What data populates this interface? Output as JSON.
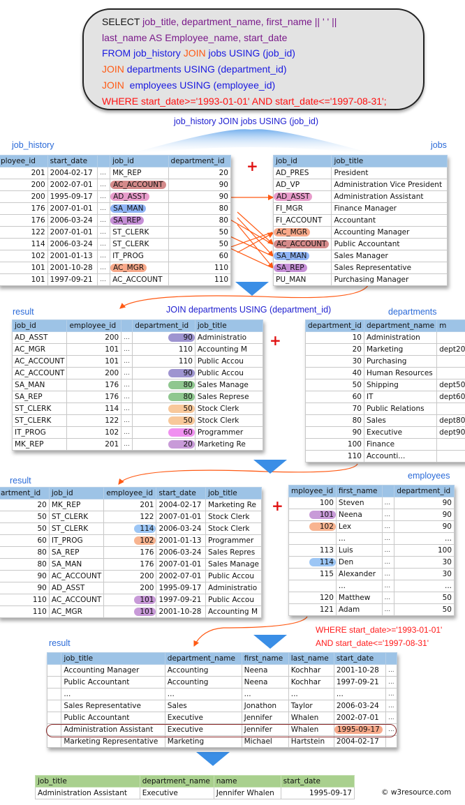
{
  "sql": {
    "lines": [
      [
        {
          "t": "SELECT ",
          "c": "black"
        },
        {
          "t": "job_title, department_name, first_name || ' ' ||",
          "c": "purple"
        }
      ],
      [
        {
          "t": "last_name AS Employee_name, start_date",
          "c": "purple"
        }
      ],
      [
        {
          "t": "FROM job_history ",
          "c": "blue"
        },
        {
          "t": "JOIN",
          "c": "orange"
        },
        {
          "t": " jobs USING (job_id)",
          "c": "blue"
        }
      ],
      [
        {
          "t": "JOIN",
          "c": "orange"
        },
        {
          "t": " departments USING (department_id)",
          "c": "blue"
        }
      ],
      [
        {
          "t": "JOIN",
          "c": "orange"
        },
        {
          "t": "  employees USING (employee_id)",
          "c": "blue"
        }
      ],
      [
        {
          "t": "WHERE start_date>='1993-01-01' AND start_date<='1997-08-31';",
          "c": "red"
        }
      ]
    ]
  },
  "captions": {
    "step1": "job_history JOIN jobs USING (job_id)",
    "step2": "JOIN departments USING (department_id)",
    "step3_line1": "WHERE start_date>='1993-01-01'",
    "step3_line2": "AND start_date<='1997-08-31'"
  },
  "labels": {
    "job_history": "job_history",
    "jobs": "jobs",
    "result1": "result",
    "departments": "departments",
    "result2": "result",
    "employees": "employees",
    "result3": "result"
  },
  "colors": {
    "ac_account": "#d48a8a",
    "ad_asst": "#e89ccb",
    "sa_man": "#8fb4f5",
    "sa_rep": "#c58fd6",
    "ac_mgr": "#f8a98a",
    "dept90": "#9e94d0",
    "dept80": "#8fc78f",
    "dept50": "#f8c89a",
    "dept60": "#f090f0",
    "dept20": "#c89ad8",
    "emp101": "#c89ad8",
    "emp102": "#f8b490",
    "emp114": "#9cc6f5",
    "final_date": "#f6a98a",
    "arrow": "#ff5a14",
    "header_blue": "#9dc3e6",
    "header_green": "#a9d08e"
  },
  "job_history": {
    "headers": [
      "ployee_id",
      "start_date",
      "",
      "job_id",
      "department_id"
    ],
    "rows": [
      [
        "201",
        "2004-02-17",
        "...",
        "MK_REP",
        "20",
        ""
      ],
      [
        "200",
        "2002-07-01",
        "...",
        "AC_ACCOUNT",
        "90",
        "ac_account"
      ],
      [
        "200",
        "1995-09-17",
        "...",
        "AD_ASST",
        "90",
        "ad_asst"
      ],
      [
        "176",
        "2007-01-01",
        "...",
        "SA_MAN",
        "80",
        "sa_man"
      ],
      [
        "176",
        "2006-03-24",
        "...",
        "SA_REP",
        "80",
        "sa_rep"
      ],
      [
        "122",
        "2007-01-01",
        "...",
        "ST_CLERK",
        "50",
        ""
      ],
      [
        "114",
        "2006-03-24",
        "...",
        "ST_CLERK",
        "50",
        ""
      ],
      [
        "102",
        "2001-01-13",
        "...",
        "IT_PROG",
        "60",
        ""
      ],
      [
        "101",
        "2001-10-28",
        "...",
        "AC_MGR",
        "110",
        "ac_mgr"
      ],
      [
        "101",
        "1997-09-21",
        "...",
        "AC_ACCOUNT",
        "110",
        ""
      ]
    ]
  },
  "jobs": {
    "headers": [
      "job_id",
      "job_title"
    ],
    "rows": [
      [
        "AD_PRES",
        "President",
        ""
      ],
      [
        "AD_VP",
        "Administration Vice President",
        ""
      ],
      [
        "AD_ASST",
        "Administration Assistant",
        "ad_asst"
      ],
      [
        "FI_MGR",
        "Finance Manager",
        ""
      ],
      [
        "FI_ACCOUNT",
        "Accountant",
        ""
      ],
      [
        "AC_MGR",
        "Accounting Manager",
        "ac_mgr"
      ],
      [
        "AC_ACCOUNT",
        "Public Accountant",
        "ac_account"
      ],
      [
        "SA_MAN",
        "Sales Manager",
        "sa_man"
      ],
      [
        "SA_REP",
        "Sales Representative",
        "sa_rep"
      ],
      [
        "PU_MAN",
        "Purchasing Manager",
        ""
      ]
    ]
  },
  "result1": {
    "headers": [
      "job_id",
      "employee_id",
      "",
      "department_id",
      "job_title"
    ],
    "rows": [
      [
        "AD_ASST",
        "200",
        "...",
        "90",
        "Administratio",
        "dept90"
      ],
      [
        "AC_MGR",
        "101",
        "...",
        "110",
        "Accounting M",
        ""
      ],
      [
        "AC_ACCOUNT",
        "101",
        "...",
        "110",
        "Public Accou",
        ""
      ],
      [
        "AC_ACCOUNT",
        "200",
        "...",
        "90",
        "Public Accou",
        "dept90"
      ],
      [
        "SA_MAN",
        "176",
        "...",
        "80",
        "Sales Manage",
        "dept80"
      ],
      [
        "SA_REP",
        "176",
        "...",
        "80",
        "Sales Represe",
        "dept80"
      ],
      [
        "ST_CLERK",
        "114",
        "...",
        "50",
        "Stock Clerk",
        "dept50"
      ],
      [
        "ST_CLERK",
        "122",
        "...",
        "50",
        "Stock Clerk",
        "dept50"
      ],
      [
        "IT_PROG",
        "102",
        "...",
        "60",
        "Programmer",
        "dept60"
      ],
      [
        "MK_REP",
        "201",
        "...",
        "20",
        "Marketing Re",
        "dept20"
      ]
    ]
  },
  "departments": {
    "headers": [
      "department_id",
      "department_name",
      "m"
    ],
    "rows": [
      [
        "10",
        "Administration",
        ""
      ],
      [
        "20",
        "Marketing",
        "dept20"
      ],
      [
        "30",
        "Purchasing",
        ""
      ],
      [
        "40",
        "Human Resources",
        ""
      ],
      [
        "50",
        "Shipping",
        "dept50"
      ],
      [
        "60",
        "IT",
        "dept60"
      ],
      [
        "70",
        "Public Relations",
        ""
      ],
      [
        "80",
        "Sales",
        "dept80"
      ],
      [
        "90",
        "Executive",
        "dept90"
      ],
      [
        "100",
        "Finance",
        ""
      ],
      [
        "110",
        "Accounti...",
        ""
      ]
    ]
  },
  "result2": {
    "headers": [
      "artment_id",
      "job_id",
      "employee_id",
      "start_date",
      "job_title"
    ],
    "rows": [
      [
        "20",
        "MK_REP",
        "201",
        "2004-02-17",
        "Marketing Re",
        ""
      ],
      [
        "50",
        "ST_CLERK",
        "122",
        "2007-01-01",
        "Stock Clerk",
        ""
      ],
      [
        "50",
        "ST_CLERK",
        "114",
        "2006-03-24",
        "Stock Clerk",
        "emp114"
      ],
      [
        "60",
        "IT_PROG",
        "102",
        "2001-01-13",
        "Programmer",
        "emp102"
      ],
      [
        "80",
        "SA_REP",
        "176",
        "2006-03-24",
        "Sales Repres",
        ""
      ],
      [
        "80",
        "SA_MAN",
        "176",
        "2007-01-01",
        "Sales Manage",
        ""
      ],
      [
        "90",
        "AC_ACCOUNT",
        "200",
        "2002-07-01",
        "Public Accou",
        ""
      ],
      [
        "90",
        "AD_ASST",
        "200",
        "1995-09-17",
        "Administratio",
        ""
      ],
      [
        "110",
        "AC_ACCOUNT",
        "101",
        "1997-09-21",
        "Public Accou",
        "emp101"
      ],
      [
        "110",
        "AC_MGR",
        "101",
        "2001-10-28",
        "Accounting M",
        "emp101"
      ]
    ]
  },
  "employees": {
    "headers": [
      "mployee_id",
      "first_name",
      "",
      "department_id"
    ],
    "rows": [
      [
        "100",
        "Steven",
        "...",
        "90",
        ""
      ],
      [
        "101",
        "Neena",
        "...",
        "90",
        "emp101"
      ],
      [
        "102",
        "Lex",
        "...",
        "90",
        "emp102"
      ],
      [
        "",
        "...",
        "...",
        "...",
        ""
      ],
      [
        "113",
        "Luis",
        "...",
        "100",
        ""
      ],
      [
        "114",
        "Den",
        "...",
        "30",
        "emp114"
      ],
      [
        "115",
        "Alexander",
        "...",
        "30",
        ""
      ],
      [
        "",
        "...",
        "...",
        "...",
        ""
      ],
      [
        "120",
        "Matthew",
        "...",
        "50",
        ""
      ],
      [
        "121",
        "Adam",
        "...",
        "50",
        ""
      ]
    ]
  },
  "result3": {
    "headers": [
      "",
      "job_title",
      "department_name",
      "first_name",
      "last_name",
      "start_date",
      ""
    ],
    "rows": [
      [
        "",
        "Accounting Manager",
        "Accounting",
        "Neena",
        "Kochhar",
        "2001-10-28",
        "..."
      ],
      [
        "",
        "Public Accountant",
        "Accounting",
        "Neena",
        "Kochhar",
        "1997-09-21",
        "..."
      ],
      [
        "",
        "...",
        "...",
        "...",
        "...",
        "...",
        "..."
      ],
      [
        "",
        "Sales Representative",
        "Sales",
        "Jonathon",
        "Taylor",
        "2006-03-24",
        "..."
      ],
      [
        "",
        "Public Accountant",
        "Executive",
        "Jennifer",
        "Whalen",
        "2002-07-01",
        "..."
      ],
      [
        "",
        "Administration Assistant",
        "Executive",
        "Jennifer",
        "Whalen",
        "1995-09-17",
        "..."
      ],
      [
        "",
        "Marketing Representative",
        "Marketing",
        "Michael",
        "Hartstein",
        "2004-02-17",
        ""
      ]
    ],
    "highlighted_row": 5
  },
  "final": {
    "headers": [
      "job_title",
      "department_name",
      "name",
      "start_date"
    ],
    "rows": [
      [
        "Administration Assistant",
        "Executive",
        "Jennifer Whalen",
        "1995-09-17"
      ]
    ]
  },
  "copyright": "© w3resource.com"
}
